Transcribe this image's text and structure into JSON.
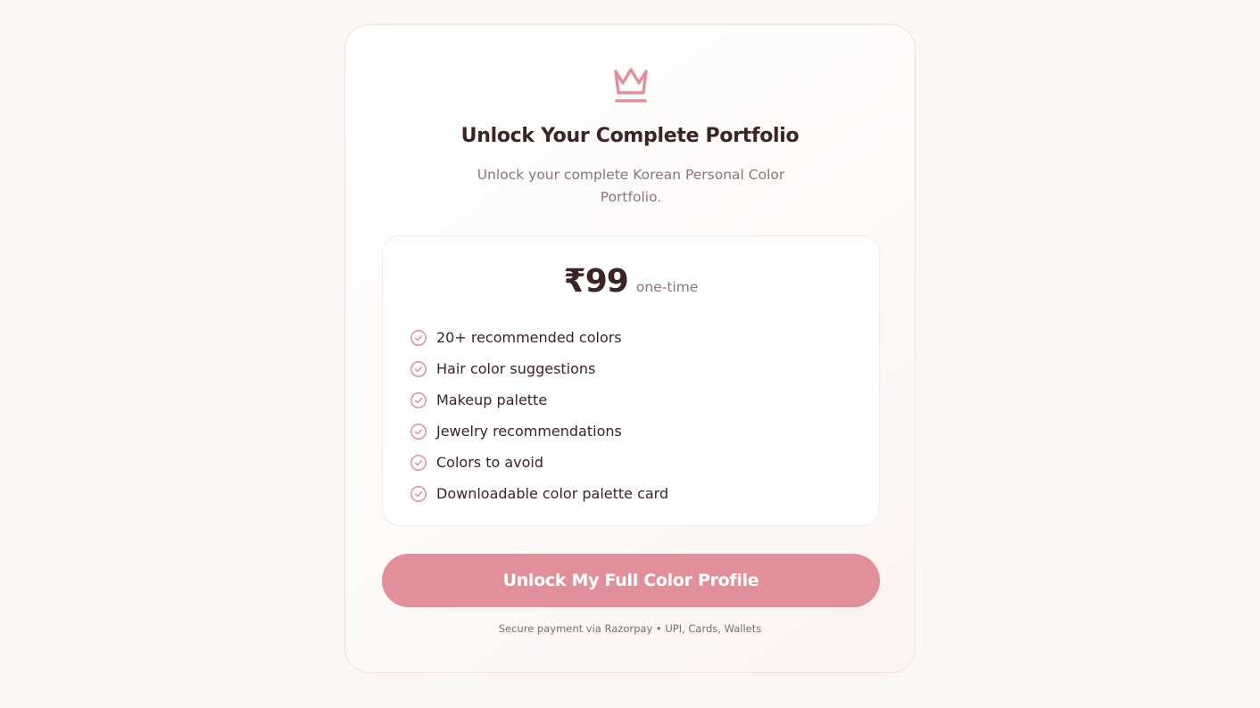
{
  "icons": {
    "header": "crown-icon",
    "feature_bullet": "check-circle-icon"
  },
  "colors": {
    "accent": "#e08f9b",
    "heading": "#3b2326",
    "muted": "#8a767a",
    "background": "#fbf8f4"
  },
  "card": {
    "title": "Unlock Your Complete Portfolio",
    "subtitle": "Unlock your complete Korean Personal Color Portfolio."
  },
  "pricing": {
    "amount": "₹99",
    "term": "one-time",
    "features": [
      "20+ recommended colors",
      "Hair color suggestions",
      "Makeup palette",
      "Jewelry recommendations",
      "Colors to avoid",
      "Downloadable color palette card"
    ]
  },
  "cta": {
    "label": "Unlock My Full Color Profile"
  },
  "footnote": "Secure payment via Razorpay • UPI, Cards, Wallets"
}
